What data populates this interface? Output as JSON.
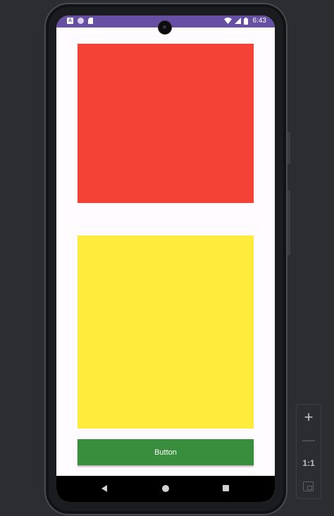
{
  "status_bar": {
    "time": "6:43",
    "notification_icons": [
      "a-badge-icon",
      "circle-icon",
      "sd-card-icon"
    ],
    "system_icons": [
      "wifi-icon",
      "cell-signal-icon",
      "battery-icon"
    ],
    "color": "#6750a4"
  },
  "content": {
    "red_box_color": "#f44336",
    "yellow_box_color": "#ffeb3b",
    "button": {
      "label": "Button",
      "color": "#388e3c"
    },
    "background": "#fffbfe"
  },
  "navigation_bar": {
    "buttons": [
      "back-icon",
      "home-icon",
      "recents-icon"
    ]
  },
  "zoom_toolbar": {
    "zoom_in": "+",
    "zoom_out": "—",
    "actual_size": "1:1",
    "fit_screen": "fit-screen-icon"
  }
}
